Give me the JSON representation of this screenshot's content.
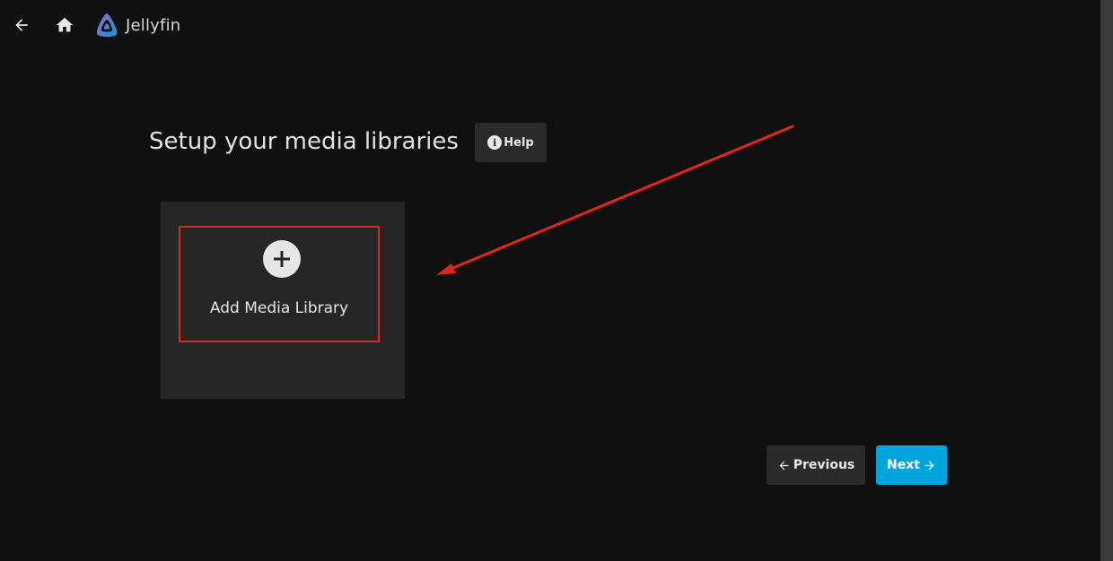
{
  "header": {
    "back_icon": "arrow-left-icon",
    "home_icon": "home-icon",
    "brand_name": "Jellyfin",
    "brand_colors": [
      "#aa5cc3",
      "#00a4dc"
    ]
  },
  "main": {
    "title": "Setup your media libraries",
    "help_label": "Help",
    "add_library_label": "Add Media Library"
  },
  "footer_nav": {
    "previous_label": "Previous",
    "next_label": "Next"
  },
  "colors": {
    "background": "#101010",
    "accent": "#00a4dc",
    "annotation": "#e0261c"
  }
}
